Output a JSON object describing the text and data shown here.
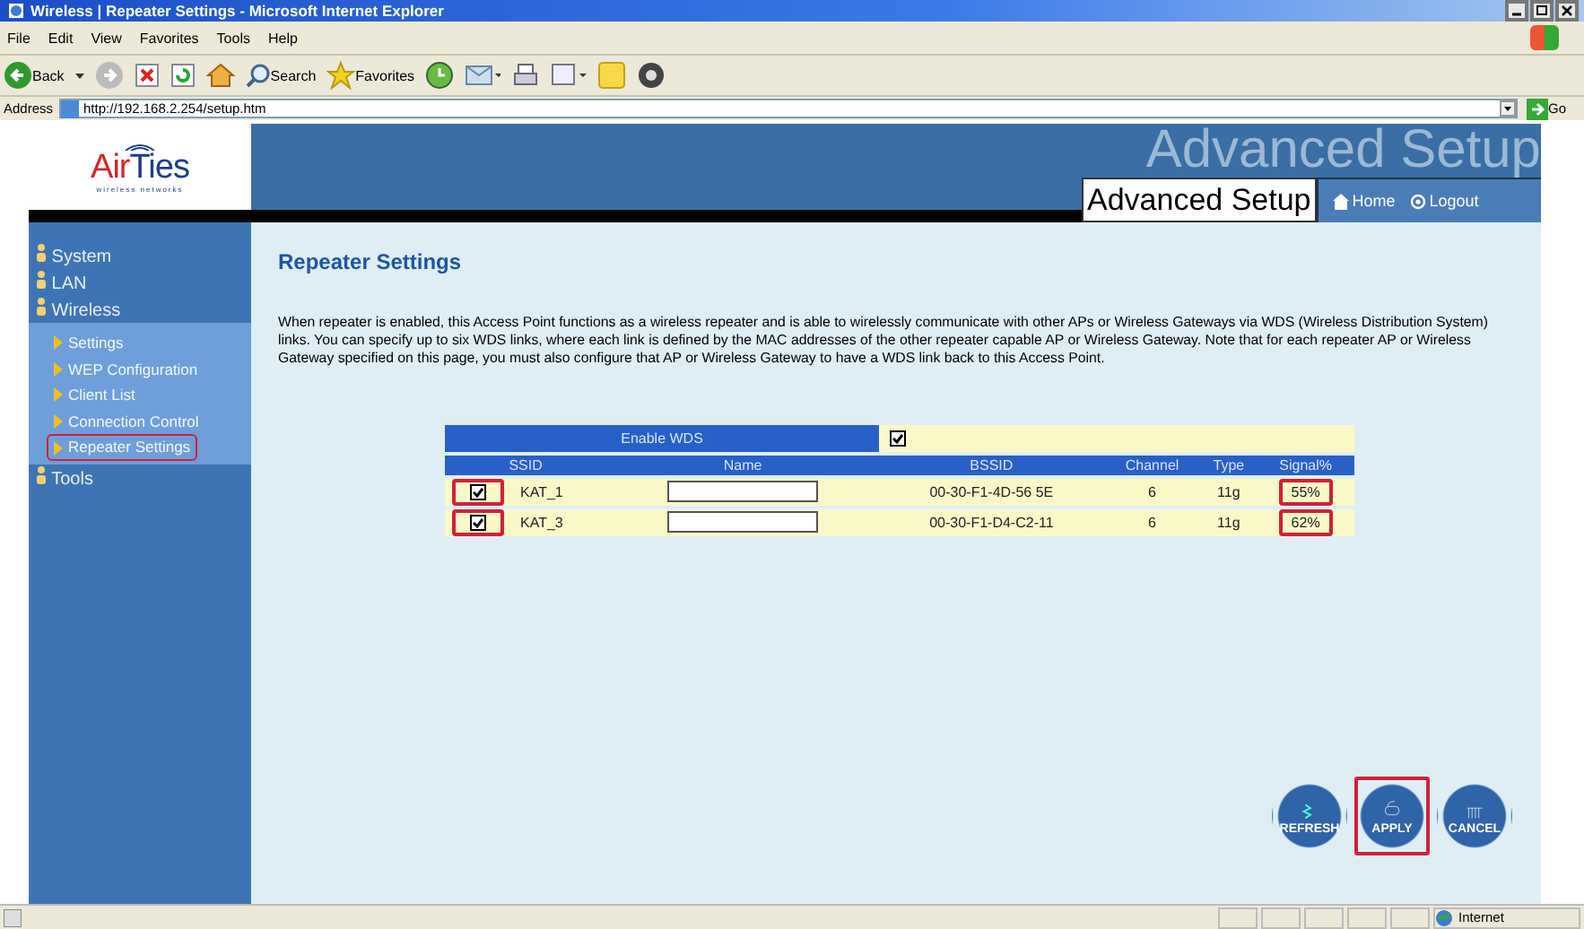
{
  "window": {
    "title": "Wireless | Repeater Settings - Microsoft Internet Explorer"
  },
  "menu": [
    "File",
    "Edit",
    "View",
    "Favorites",
    "Tools",
    "Help"
  ],
  "toolbar": {
    "back": "Back",
    "search": "Search",
    "favorites": "Favorites"
  },
  "address": {
    "label": "Address",
    "value": "http://192.168.2.254/setup.htm",
    "go": "Go"
  },
  "header": {
    "logo": "AirTies",
    "tagline": "wireless networks",
    "banner": "Advanced Setup",
    "title": "Advanced Setup",
    "links": [
      "Home",
      "Logout"
    ]
  },
  "sidebar": {
    "items": [
      {
        "label": "System"
      },
      {
        "label": "LAN"
      },
      {
        "label": "Wireless",
        "children": [
          {
            "label": "Settings",
            "highlighted": false
          },
          {
            "label": "WEP Configuration",
            "highlighted": false
          },
          {
            "label": "Client List",
            "highlighted": false
          },
          {
            "label": "Connection Control",
            "highlighted": false
          },
          {
            "label": "Repeater Settings",
            "highlighted": true
          }
        ]
      },
      {
        "label": "Tools"
      }
    ]
  },
  "content": {
    "heading": "Repeater Settings",
    "description": "When repeater is enabled, this Access Point functions as a wireless repeater and is able to wirelessly communicate with other APs or Wireless Gateways via WDS (Wireless Distribution System) links. You can specify up to six WDS links, where each link is defined by the MAC addresses of the other repeater capable AP or Wireless Gateway. Note that for each repeater AP or Wireless Gateway specified on this page, you must also configure that AP or Wireless Gateway to have a WDS link back to this Access Point.",
    "enable_wds": {
      "label": "Enable WDS",
      "checked": true
    },
    "table": {
      "columns": [
        "SSID",
        "Name",
        "BSSID",
        "Channel",
        "Type",
        "Signal%"
      ],
      "rows": [
        {
          "checked": true,
          "highlighted": true,
          "ssid": "KAT_1",
          "name": "",
          "bssid": "00-30-F1-4D-56 5E",
          "channel": "6",
          "type": "11g",
          "signal": "55%",
          "signal_highlighted": true
        },
        {
          "checked": true,
          "highlighted": true,
          "ssid": "KAT_3",
          "name": "",
          "bssid": "00-30-F1-D4-C2-11",
          "channel": "6",
          "type": "11g",
          "signal": "62%",
          "signal_highlighted": true
        }
      ]
    },
    "buttons": [
      {
        "label": "REFRESH",
        "kind": "refresh",
        "highlighted": false
      },
      {
        "label": "APPLY",
        "kind": "apply",
        "highlighted": true
      },
      {
        "label": "CANCEL",
        "kind": "cancel",
        "highlighted": false
      }
    ]
  },
  "status_bar": {
    "zone": "Internet"
  }
}
